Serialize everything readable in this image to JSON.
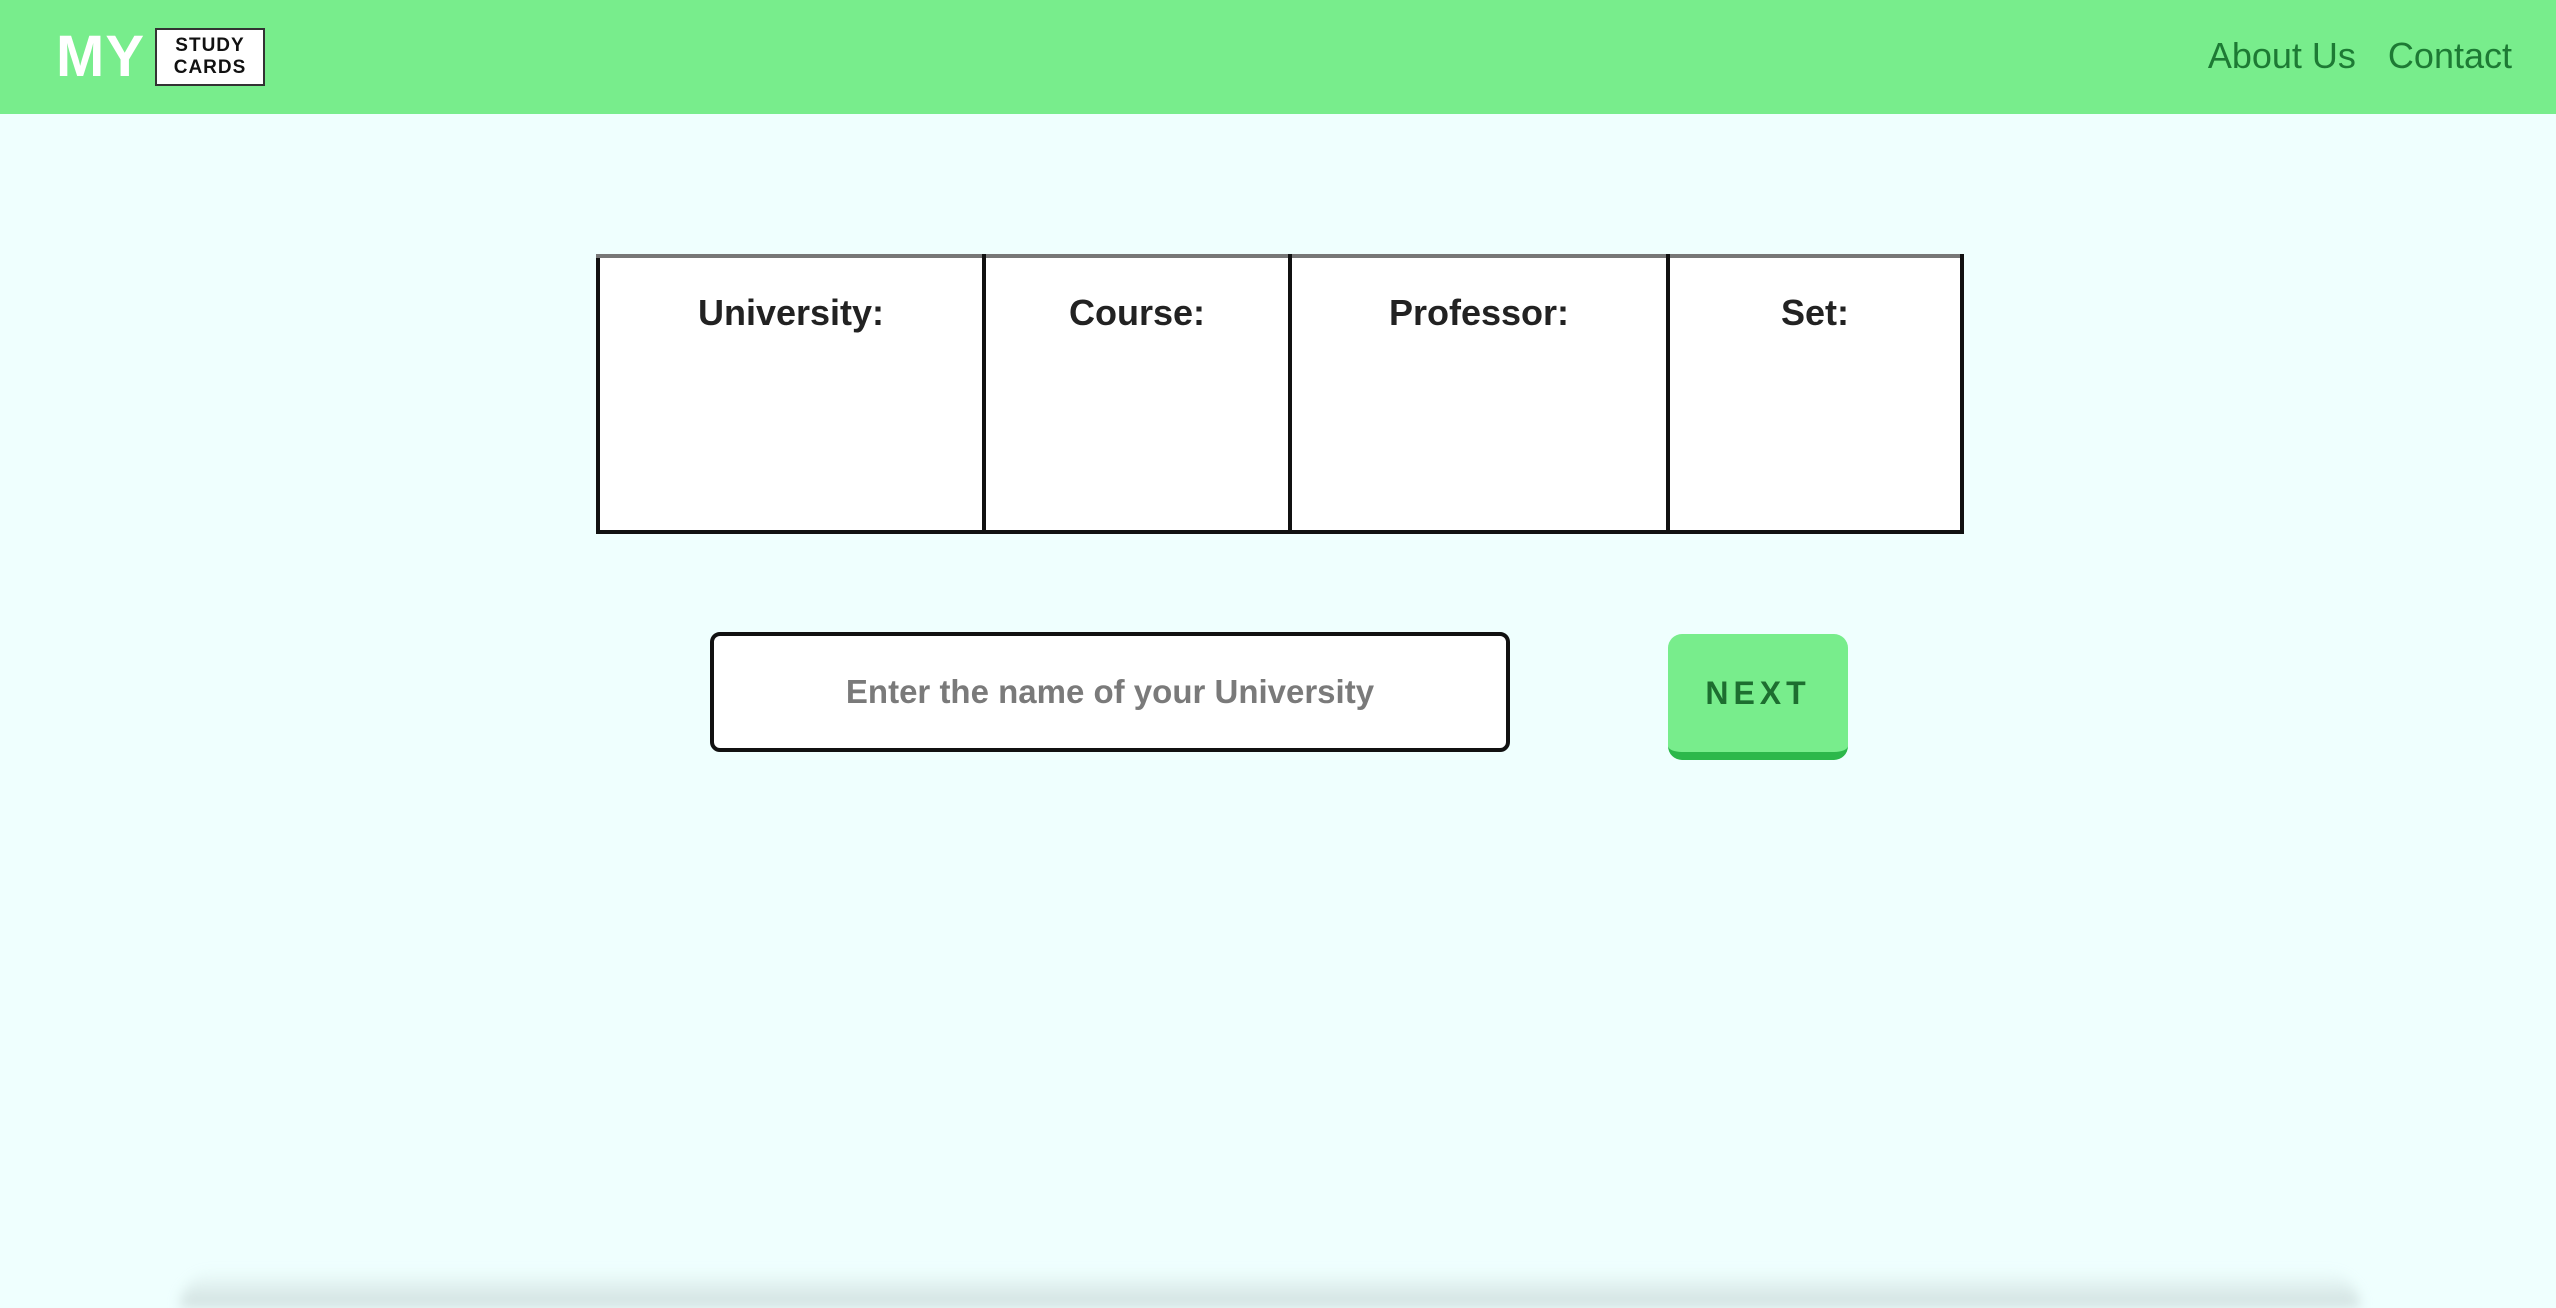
{
  "header": {
    "logo_main": "MY",
    "logo_box_line1": "STUDY",
    "logo_box_line2": "CARDS",
    "nav": [
      {
        "label": "About Us"
      },
      {
        "label": "Contact"
      }
    ]
  },
  "selection_table": {
    "columns": [
      {
        "label": "University:"
      },
      {
        "label": "Course:"
      },
      {
        "label": "Professor:"
      },
      {
        "label": "Set:"
      }
    ]
  },
  "search": {
    "value": "",
    "placeholder": "Enter the name of your University"
  },
  "next_button": {
    "label": "NEXT"
  },
  "colors": {
    "header_bg": "#78ed8c",
    "page_bg": "#effffe",
    "nav_text": "#1d7a34",
    "button_bg": "#78ed8c",
    "button_shadow": "#2cb84a"
  }
}
